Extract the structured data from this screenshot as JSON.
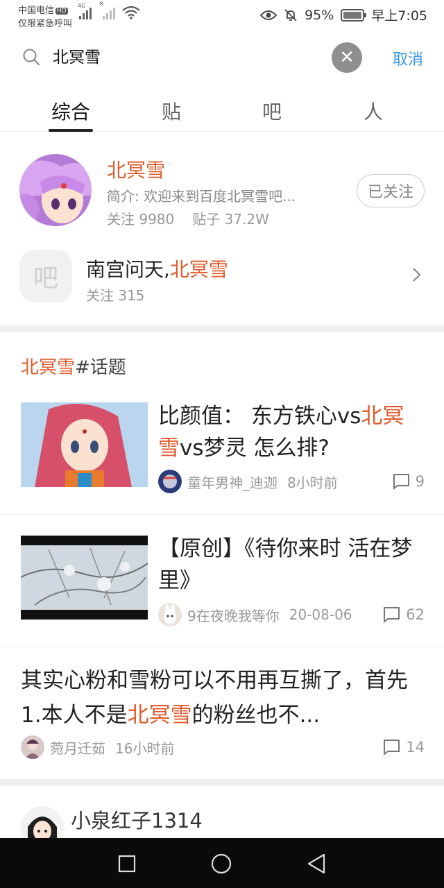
{
  "status_bar": {
    "carrier_line1": "中国电信",
    "hd_badge": "HD",
    "carrier_line2": "仅限紧急呼叫",
    "network_type": "4G",
    "battery_percent": "95%",
    "time": "早上7:05",
    "icons": [
      "signal-icon",
      "wifi-icon",
      "eye-icon",
      "mute-bell-icon",
      "battery-icon"
    ]
  },
  "search": {
    "query": "北冥雪",
    "clear_icon": "close-icon",
    "cancel_label": "取消"
  },
  "tabs": [
    {
      "label": "综合",
      "active": true
    },
    {
      "label": "贴",
      "active": false
    },
    {
      "label": "吧",
      "active": false
    },
    {
      "label": "人",
      "active": false
    }
  ],
  "bar_result": {
    "name": "北冥雪",
    "intro": "简介: 欢迎来到百度北冥雪吧...",
    "follow_count": "关注 9980",
    "post_count": "贴子 37.2W",
    "follow_button": "已关注"
  },
  "bar_result_2": {
    "icon_char": "吧",
    "name_prefix": "南宫问天,",
    "name_highlight": "北冥雪",
    "follow_count": "关注 315"
  },
  "topic_section": {
    "highlight": "北冥雪",
    "suffix": "#话题"
  },
  "posts": [
    {
      "title_a": "比颜值： 东方铁心vs",
      "title_hl_a": "北",
      "title_hl_b": "冥雪",
      "title_b": "vs梦灵 怎么排?",
      "author": "童年男神_迪迦",
      "time": "8小时前",
      "comments": "9"
    },
    {
      "title": "【原创】《待你来时 活在梦里》",
      "author": "9在夜晚我等你",
      "time": "20-08-06",
      "comments": "62"
    },
    {
      "title_a": "其实心粉和雪粉可以不用再互撕了，首先 1.本人不是",
      "title_hl": "北冥雪",
      "title_b": "的粉丝也不...",
      "author": "菀月迁茹",
      "time": "16小时前",
      "comments": "14"
    }
  ],
  "user_result": {
    "name": "小泉红子1314"
  },
  "colors": {
    "highlight": "#e05a2b",
    "cancel_blue": "#3a97e6"
  }
}
